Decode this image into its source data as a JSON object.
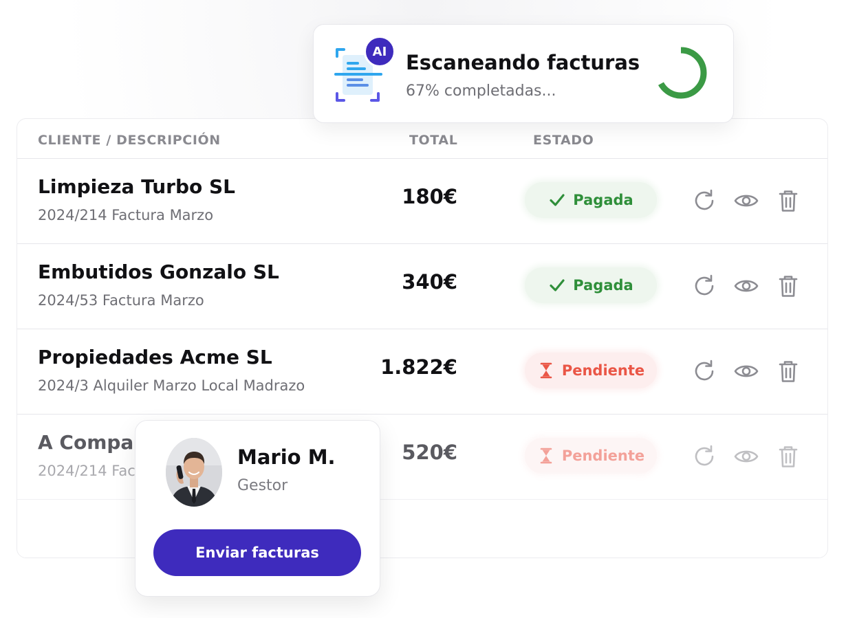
{
  "table": {
    "headers": {
      "client": "CLIENTE / DESCRIPCIÓN",
      "total": "TOTAL",
      "status": "ESTADO"
    },
    "rows": [
      {
        "client": "Limpieza Turbo SL",
        "description": "2024/214 Factura Marzo",
        "total": "180€",
        "status": "Pagada",
        "status_type": "paid",
        "status_icon": "check-icon"
      },
      {
        "client": "Embutidos Gonzalo SL",
        "description": "2024/53 Factura Marzo",
        "total": "340€",
        "status": "Pagada",
        "status_type": "paid",
        "status_icon": "check-icon"
      },
      {
        "client": "Propiedades Acme SL",
        "description": "2024/3 Alquiler Marzo Local Madrazo",
        "total": "1.822€",
        "status": "Pendiente",
        "status_type": "pending",
        "status_icon": "hourglass-icon"
      },
      {
        "client": "A Compa",
        "description": "2024/214 Fac",
        "total": "520€",
        "status": "Pendiente",
        "status_type": "pending",
        "status_icon": "hourglass-icon"
      }
    ],
    "row_actions": [
      "refresh-icon",
      "eye-icon",
      "trash-icon"
    ]
  },
  "scan": {
    "badge": "AI",
    "title": "Escaneando facturas",
    "subtitle": "67% completadas...",
    "progress": 0.67,
    "icon": "document-scan-icon"
  },
  "manager": {
    "name": "Mario M.",
    "role": "Gestor",
    "button_label": "Enviar facturas",
    "avatar": "avatar-photo"
  },
  "colors": {
    "primary": "#3e2bbd",
    "paid_text": "#2f8f3a",
    "paid_bg": "#eef6ee",
    "pending_text": "#ea5646",
    "pending_bg": "#fdeeee",
    "spinner": "#3b9a45"
  }
}
